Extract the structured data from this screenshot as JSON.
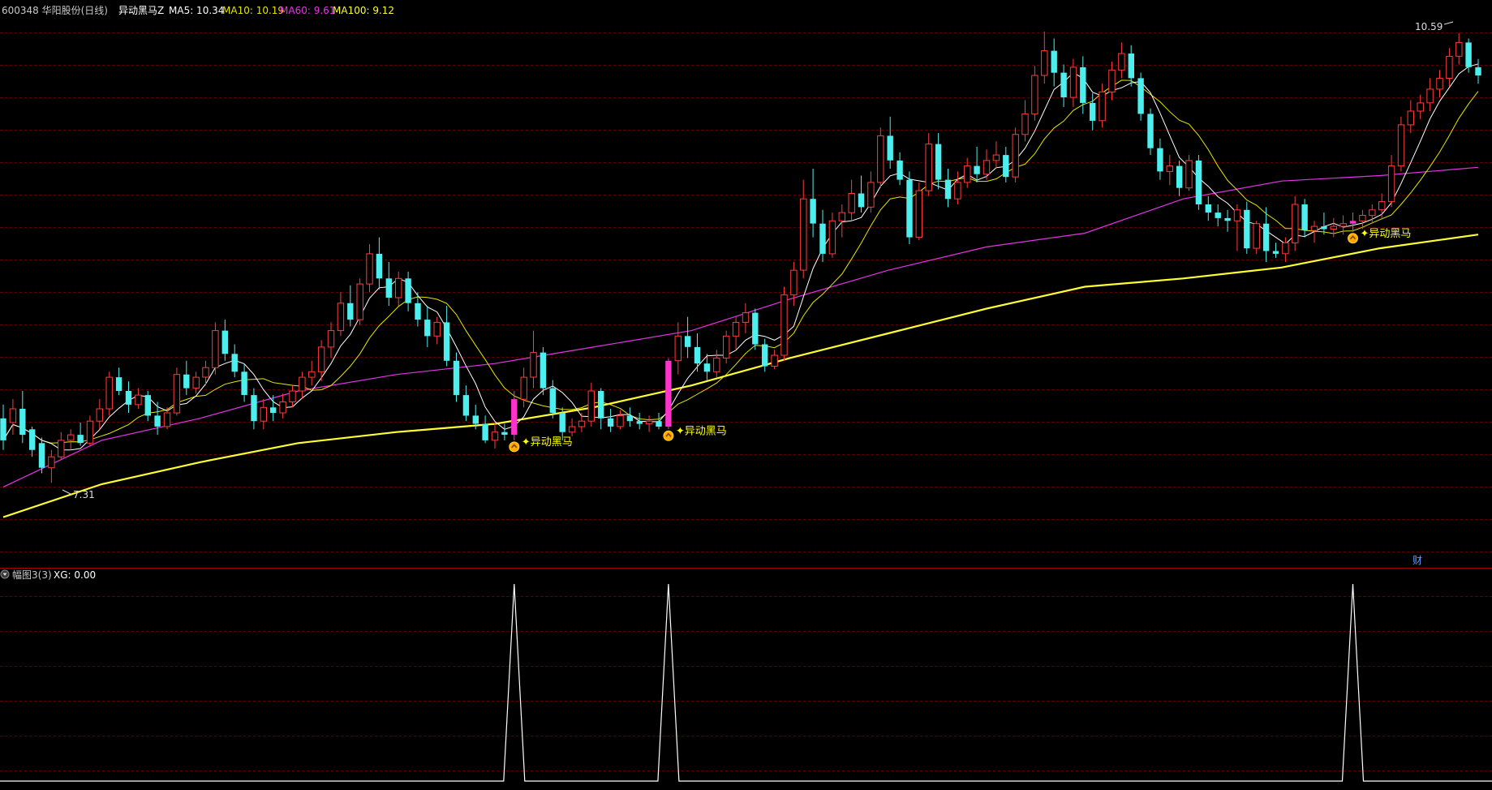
{
  "header": {
    "stock": "600348 华阳股份(日线)",
    "indicator": "异动黑马Z",
    "ma5": "MA5: 10.34",
    "ma10": "MA10: 10.19",
    "ma60": "MA60: 9.61",
    "ma100": "MA100: 9.12"
  },
  "colors": {
    "up": "#ff3b3b",
    "down": "#4deeee",
    "signal_bar": "#ff33cc",
    "ma5": "#ffffff",
    "ma10": "#e6e600",
    "ma60": "#e633e6",
    "ma100": "#ffff33",
    "grid": "#5a0000",
    "signal_text": "#ffff00"
  },
  "price_labels": {
    "high": "10.59",
    "low": "7.31"
  },
  "signal_label": "异动黑马",
  "fin_badge": "财",
  "subpanel": {
    "title": "幅图3(3)",
    "xg": "XG: 0.00"
  },
  "chart_data": [
    {
      "type": "candlestick",
      "title": "600348 华阳股份(日线)",
      "indicators": [
        "MA5",
        "MA10",
        "MA60",
        "MA100"
      ],
      "ylim": [
        6.75,
        10.7
      ],
      "grid": "horizontal dashed",
      "candles": [
        [
          7.78,
          7.88,
          7.55,
          7.62
        ],
        [
          7.75,
          7.92,
          7.66,
          7.85
        ],
        [
          7.85,
          7.98,
          7.6,
          7.66
        ],
        [
          7.7,
          7.72,
          7.5,
          7.55
        ],
        [
          7.6,
          7.64,
          7.38,
          7.42
        ],
        [
          7.42,
          7.55,
          7.31,
          7.5
        ],
        [
          7.5,
          7.68,
          7.48,
          7.62
        ],
        [
          7.62,
          7.7,
          7.55,
          7.66
        ],
        [
          7.66,
          7.75,
          7.58,
          7.6
        ],
        [
          7.6,
          7.8,
          7.58,
          7.76
        ],
        [
          7.76,
          7.92,
          7.7,
          7.85
        ],
        [
          7.85,
          8.12,
          7.8,
          8.08
        ],
        [
          8.08,
          8.15,
          7.95,
          7.98
        ],
        [
          7.98,
          8.05,
          7.82,
          7.88
        ],
        [
          7.88,
          8.0,
          7.85,
          7.95
        ],
        [
          7.95,
          7.98,
          7.76,
          7.8
        ],
        [
          7.8,
          7.9,
          7.66,
          7.72
        ],
        [
          7.72,
          7.86,
          7.7,
          7.82
        ],
        [
          7.82,
          8.15,
          7.8,
          8.1
        ],
        [
          8.1,
          8.2,
          7.95,
          8.0
        ],
        [
          8.0,
          8.12,
          7.96,
          8.08
        ],
        [
          8.08,
          8.2,
          8.02,
          8.15
        ],
        [
          8.15,
          8.48,
          8.1,
          8.42
        ],
        [
          8.42,
          8.5,
          8.2,
          8.25
        ],
        [
          8.25,
          8.32,
          8.08,
          8.12
        ],
        [
          8.12,
          8.18,
          7.9,
          7.95
        ],
        [
          7.95,
          8.0,
          7.7,
          7.76
        ],
        [
          7.76,
          7.92,
          7.7,
          7.86
        ],
        [
          7.86,
          7.95,
          7.76,
          7.82
        ],
        [
          7.82,
          7.96,
          7.78,
          7.9
        ],
        [
          7.9,
          8.02,
          7.86,
          7.98
        ],
        [
          7.98,
          8.12,
          7.92,
          8.08
        ],
        [
          8.08,
          8.2,
          8.02,
          8.12
        ],
        [
          8.12,
          8.35,
          8.05,
          8.3
        ],
        [
          8.3,
          8.48,
          8.22,
          8.42
        ],
        [
          8.42,
          8.7,
          8.38,
          8.62
        ],
        [
          8.62,
          8.75,
          8.45,
          8.5
        ],
        [
          8.5,
          8.8,
          8.46,
          8.76
        ],
        [
          8.76,
          9.05,
          8.7,
          8.98
        ],
        [
          8.98,
          9.1,
          8.72,
          8.8
        ],
        [
          8.8,
          8.92,
          8.6,
          8.66
        ],
        [
          8.66,
          8.85,
          8.6,
          8.8
        ],
        [
          8.8,
          8.85,
          8.56,
          8.62
        ],
        [
          8.62,
          8.7,
          8.45,
          8.5
        ],
        [
          8.5,
          8.6,
          8.3,
          8.38
        ],
        [
          8.38,
          8.52,
          8.32,
          8.48
        ],
        [
          8.48,
          8.6,
          8.16,
          8.2
        ],
        [
          8.2,
          8.26,
          7.9,
          7.95
        ],
        [
          7.95,
          8.02,
          7.76,
          7.8
        ],
        [
          7.8,
          7.88,
          7.7,
          7.74
        ],
        [
          7.74,
          7.8,
          7.6,
          7.62
        ],
        [
          7.62,
          7.75,
          7.56,
          7.68
        ],
        [
          7.68,
          7.74,
          7.62,
          7.66
        ],
        [
          7.66,
          7.98,
          7.62,
          7.92
        ],
        [
          7.92,
          8.15,
          7.86,
          8.08
        ],
        [
          8.08,
          8.42,
          8.0,
          8.26
        ],
        [
          8.26,
          8.3,
          7.95,
          8.0
        ],
        [
          8.0,
          8.06,
          7.78,
          7.82
        ],
        [
          7.82,
          7.86,
          7.62,
          7.68
        ],
        [
          7.68,
          7.78,
          7.65,
          7.72
        ],
        [
          7.72,
          7.82,
          7.68,
          7.76
        ],
        [
          7.76,
          8.04,
          7.72,
          7.98
        ],
        [
          7.98,
          8.0,
          7.7,
          7.78
        ],
        [
          7.78,
          7.85,
          7.68,
          7.72
        ],
        [
          7.72,
          7.84,
          7.7,
          7.8
        ],
        [
          7.8,
          7.86,
          7.72,
          7.76
        ],
        [
          7.76,
          7.82,
          7.7,
          7.74
        ],
        [
          7.74,
          7.8,
          7.68,
          7.76
        ],
        [
          7.76,
          7.82,
          7.7,
          7.72
        ],
        [
          7.72,
          8.22,
          7.7,
          8.2
        ],
        [
          8.2,
          8.48,
          8.1,
          8.38
        ],
        [
          8.38,
          8.52,
          8.22,
          8.3
        ],
        [
          8.3,
          8.4,
          8.12,
          8.18
        ],
        [
          8.18,
          8.25,
          8.06,
          8.12
        ],
        [
          8.12,
          8.28,
          8.08,
          8.22
        ],
        [
          8.22,
          8.42,
          8.18,
          8.38
        ],
        [
          8.38,
          8.52,
          8.28,
          8.48
        ],
        [
          8.48,
          8.62,
          8.4,
          8.55
        ],
        [
          8.55,
          8.58,
          8.28,
          8.32
        ],
        [
          8.32,
          8.36,
          8.12,
          8.16
        ],
        [
          8.16,
          8.28,
          8.14,
          8.24
        ],
        [
          8.24,
          8.74,
          8.2,
          8.68
        ],
        [
          8.68,
          8.92,
          8.6,
          8.86
        ],
        [
          8.86,
          9.52,
          8.8,
          9.38
        ],
        [
          9.38,
          9.6,
          9.1,
          9.2
        ],
        [
          9.2,
          9.3,
          8.92,
          8.98
        ],
        [
          8.98,
          9.28,
          8.95,
          9.22
        ],
        [
          9.22,
          9.34,
          9.1,
          9.28
        ],
        [
          9.28,
          9.52,
          9.22,
          9.42
        ],
        [
          9.42,
          9.55,
          9.28,
          9.32
        ],
        [
          9.32,
          9.58,
          9.28,
          9.5
        ],
        [
          9.5,
          9.9,
          9.46,
          9.84
        ],
        [
          9.84,
          9.98,
          9.6,
          9.66
        ],
        [
          9.66,
          9.72,
          9.48,
          9.52
        ],
        [
          9.52,
          9.58,
          9.05,
          9.1
        ],
        [
          9.1,
          9.5,
          9.08,
          9.44
        ],
        [
          9.44,
          9.86,
          9.4,
          9.78
        ],
        [
          9.78,
          9.86,
          9.45,
          9.52
        ],
        [
          9.52,
          9.6,
          9.32,
          9.38
        ],
        [
          9.38,
          9.58,
          9.34,
          9.5
        ],
        [
          9.5,
          9.68,
          9.46,
          9.62
        ],
        [
          9.62,
          9.76,
          9.5,
          9.56
        ],
        [
          9.56,
          9.74,
          9.52,
          9.66
        ],
        [
          9.66,
          9.8,
          9.6,
          9.7
        ],
        [
          9.7,
          9.76,
          9.5,
          9.54
        ],
        [
          9.54,
          9.9,
          9.5,
          9.85
        ],
        [
          9.85,
          10.1,
          9.8,
          10.0
        ],
        [
          10.0,
          10.35,
          9.95,
          10.28
        ],
        [
          10.28,
          10.6,
          10.22,
          10.46
        ],
        [
          10.46,
          10.55,
          10.2,
          10.3
        ],
        [
          10.3,
          10.36,
          10.05,
          10.12
        ],
        [
          10.12,
          10.4,
          10.05,
          10.34
        ],
        [
          10.34,
          10.42,
          10.0,
          10.08
        ],
        [
          10.08,
          10.15,
          9.88,
          9.95
        ],
        [
          9.95,
          10.22,
          9.9,
          10.16
        ],
        [
          10.16,
          10.38,
          10.1,
          10.32
        ],
        [
          10.32,
          10.52,
          10.26,
          10.44
        ],
        [
          10.44,
          10.5,
          10.2,
          10.26
        ],
        [
          10.26,
          10.3,
          9.95,
          10.0
        ],
        [
          10.0,
          10.04,
          9.7,
          9.75
        ],
        [
          9.75,
          9.82,
          9.52,
          9.58
        ],
        [
          9.58,
          9.7,
          9.48,
          9.62
        ],
        [
          9.62,
          9.66,
          9.4,
          9.46
        ],
        [
          9.46,
          9.7,
          9.44,
          9.66
        ],
        [
          9.66,
          9.7,
          9.3,
          9.34
        ],
        [
          9.34,
          9.4,
          9.22,
          9.28
        ],
        [
          9.28,
          9.34,
          9.18,
          9.24
        ],
        [
          9.24,
          9.3,
          9.14,
          9.22
        ],
        [
          9.22,
          9.34,
          9.0,
          9.3
        ],
        [
          9.3,
          9.36,
          8.98,
          9.02
        ],
        [
          9.02,
          9.22,
          8.98,
          9.2
        ],
        [
          9.2,
          9.32,
          8.92,
          9.0
        ],
        [
          9.0,
          9.06,
          8.95,
          8.98
        ],
        [
          8.98,
          9.1,
          8.92,
          9.06
        ],
        [
          9.06,
          9.4,
          9.0,
          9.34
        ],
        [
          9.34,
          9.38,
          9.1,
          9.15
        ],
        [
          9.15,
          9.22,
          9.06,
          9.18
        ],
        [
          9.18,
          9.28,
          9.12,
          9.16
        ],
        [
          9.16,
          9.24,
          9.1,
          9.18
        ],
        [
          9.18,
          9.26,
          9.12,
          9.2
        ],
        [
          9.2,
          9.28,
          9.14,
          9.22
        ],
        [
          9.22,
          9.3,
          9.16,
          9.26
        ],
        [
          9.26,
          9.34,
          9.2,
          9.3
        ],
        [
          9.3,
          9.42,
          9.24,
          9.36
        ],
        [
          9.36,
          9.7,
          9.32,
          9.62
        ],
        [
          9.62,
          9.98,
          9.58,
          9.92
        ],
        [
          9.92,
          10.1,
          9.86,
          10.02
        ],
        [
          10.02,
          10.14,
          9.96,
          10.08
        ],
        [
          10.08,
          10.26,
          10.02,
          10.18
        ],
        [
          10.18,
          10.32,
          10.12,
          10.26
        ],
        [
          10.26,
          10.48,
          10.2,
          10.42
        ],
        [
          10.42,
          10.59,
          10.36,
          10.52
        ],
        [
          10.52,
          10.55,
          10.3,
          10.34
        ],
        [
          10.34,
          10.4,
          10.22,
          10.28
        ]
      ],
      "ma60": [
        7.28,
        7.62,
        7.78,
        7.98,
        8.1,
        8.18,
        8.3,
        8.42,
        8.65,
        8.86,
        9.03,
        9.13,
        9.38,
        9.51,
        9.55,
        9.61
      ],
      "ma100": [
        7.06,
        7.3,
        7.46,
        7.6,
        7.68,
        7.74,
        7.86,
        8.02,
        8.22,
        8.4,
        8.58,
        8.74,
        8.8,
        8.88,
        9.02,
        9.12
      ],
      "signals": [
        {
          "index": 53,
          "label": "异动黑马"
        },
        {
          "index": 69,
          "label": "异动黑马"
        },
        {
          "index": 140,
          "label": "异动黑马"
        }
      ]
    },
    {
      "type": "line",
      "title": "幅图3(3)",
      "series": [
        {
          "name": "XG",
          "spikes_at": [
            53,
            69,
            140
          ],
          "values_range": [
            0,
            1
          ]
        }
      ]
    }
  ]
}
